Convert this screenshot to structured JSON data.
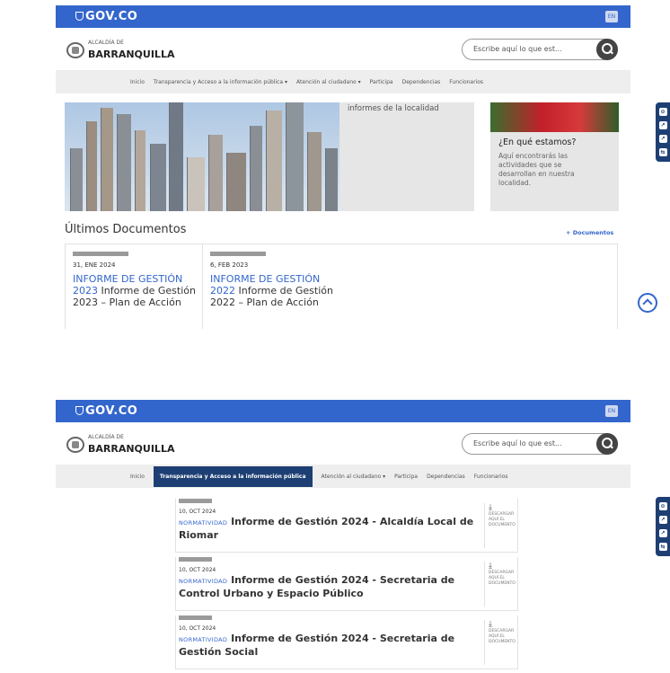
{
  "gov": {
    "logo": "GOV.CO",
    "lang": "EN"
  },
  "brand": {
    "small": "ALCALDÍA DE",
    "big": "BARRANQUILLA"
  },
  "search": {
    "placeholder1": "Escribe aquí lo que est...",
    "placeholder2": "Escribe aquí lo que est..."
  },
  "nav": {
    "items": [
      "Inicio",
      "Transparencia y Acceso a la información pública ▾",
      "Atención al ciudadano ▾",
      "Participa",
      "Dependencias",
      "Funcionarios"
    ],
    "items2": [
      "Inicio",
      "Transparencia y Acceso a la información pública",
      "Atención al ciudadano ▾",
      "Participa",
      "Dependencias",
      "Funcionarios"
    ]
  },
  "side_icons": [
    "⊙",
    "↗",
    "↗",
    "⇆"
  ],
  "frame1": {
    "panel_text": "informes de la localidad",
    "card": {
      "title": "¿En qué estamos?",
      "text": "Aquí encontrarás las actividades que se desarrollan en nuestra localidad."
    },
    "section_title": "Últimos Documentos",
    "more_link": "+ Documentos",
    "docs": [
      {
        "date": "31, ENE 2024",
        "keyword": "INFORME DE GESTIÓN 2023",
        "title": " Informe de Gestión 2023 – Plan de Acción"
      },
      {
        "date": "6, FEB 2023",
        "keyword": "INFORME DE GESTIÓN 2022",
        "title": " Informe de Gestión 2022 – Plan de Acción"
      }
    ]
  },
  "frame2": {
    "items": [
      {
        "date": "10, OCT 2024",
        "keyword": "NORMATIVIDAD",
        "title": "Informe de Gestión 2024 - Alcaldía Local de Riomar",
        "download": "DESCARGAR AQUÍ EL DOCUMENTO"
      },
      {
        "date": "10, OCT 2024",
        "keyword": "NORMATIVIDAD",
        "title": "Informe de Gestión 2024 - Secretaria de Control Urbano y Espacio Público",
        "download": "DESCARGAR AQUÍ EL DOCUMENTO"
      },
      {
        "date": "10, OCT 2024",
        "keyword": "NORMATIVIDAD",
        "title": "Informe de Gestión 2024 - Secretaria de Gestión Social",
        "download": "DESCARGAR AQUÍ EL DOCUMENTO"
      }
    ]
  }
}
